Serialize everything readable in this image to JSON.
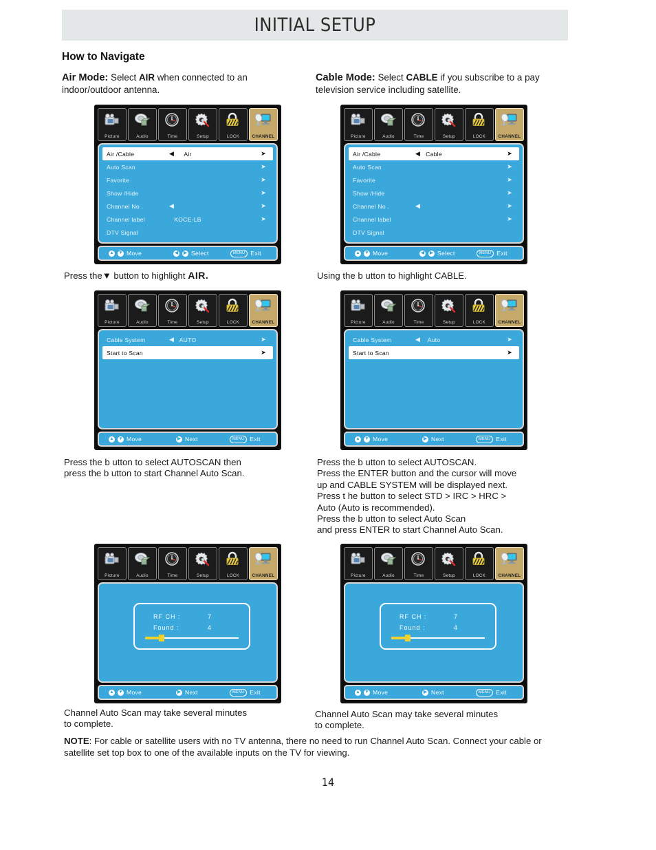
{
  "header": {
    "title": "INITIAL SETUP"
  },
  "section": {
    "how_to_navigate": "How to Navigate"
  },
  "intro": {
    "air": {
      "lead": "Air Mode:",
      "t1": " Select ",
      "bold1": "AIR",
      "t2": " when connected to an indoor/outdoor antenna."
    },
    "cable": {
      "lead": "Cable Mode:",
      "t1": " Select ",
      "bold1": "CABLE",
      "t2": " if you subscribe to a pay television service including satellite."
    }
  },
  "tabs": [
    {
      "label": "Picture",
      "icon": "camera-icon"
    },
    {
      "label": "Audio",
      "icon": "speaker-icon"
    },
    {
      "label": "Time",
      "icon": "clock-icon"
    },
    {
      "label": "Setup",
      "icon": "gear-wrench-icon"
    },
    {
      "label": "LOCK",
      "icon": "padlock-icon"
    },
    {
      "label": "CHANNEL",
      "icon": "monitor-antenna-icon"
    }
  ],
  "footers": {
    "move": "Move",
    "select": "Select",
    "next": "Next",
    "exit": "Exit",
    "menu_btn": "MENU"
  },
  "menu_air": {
    "rows": [
      {
        "label": "Air /Cable",
        "value": "Air",
        "left_arrow": true,
        "right_arrow": true,
        "selected": true
      },
      {
        "label": "Auto  Scan",
        "value": "",
        "left_arrow": false,
        "right_arrow": true,
        "selected": false
      },
      {
        "label": "Favorite",
        "value": "",
        "left_arrow": false,
        "right_arrow": true,
        "selected": false
      },
      {
        "label": "Show /Hide",
        "value": "",
        "left_arrow": false,
        "right_arrow": true,
        "selected": false
      },
      {
        "label": "Channel No .",
        "value": "",
        "left_arrow": true,
        "right_arrow": true,
        "selected": false
      },
      {
        "label": "Channel label",
        "value": "KOCE-LB",
        "left_arrow": false,
        "right_arrow": true,
        "selected": false
      },
      {
        "label": "DTV Signal",
        "value": "",
        "left_arrow": false,
        "right_arrow": false,
        "selected": false
      }
    ]
  },
  "menu_cable": {
    "rows": [
      {
        "label": "Air /Cable",
        "value": "Cable",
        "left_arrow": true,
        "right_arrow": true,
        "selected": true
      },
      {
        "label": "Auto  Scan",
        "value": "",
        "left_arrow": false,
        "right_arrow": true,
        "selected": false
      },
      {
        "label": "Favorite",
        "value": "",
        "left_arrow": false,
        "right_arrow": true,
        "selected": false
      },
      {
        "label": "Show /Hide",
        "value": "",
        "left_arrow": false,
        "right_arrow": true,
        "selected": false
      },
      {
        "label": "Channel No .",
        "value": "",
        "left_arrow": true,
        "right_arrow": true,
        "selected": false
      },
      {
        "label": "Channel label",
        "value": "",
        "left_arrow": false,
        "right_arrow": true,
        "selected": false
      },
      {
        "label": "DTV Signal",
        "value": "",
        "left_arrow": false,
        "right_arrow": false,
        "selected": false
      }
    ]
  },
  "menu_scan_air": {
    "rows": [
      {
        "label": "Cable System",
        "value": "AUTO",
        "left_arrow": true,
        "right_arrow": true,
        "selected": false
      },
      {
        "label": "Start  to Scan",
        "value": "",
        "left_arrow": false,
        "right_arrow": true,
        "selected": true
      }
    ]
  },
  "menu_scan_cable": {
    "rows": [
      {
        "label": "Cable System",
        "value": "Auto",
        "left_arrow": true,
        "right_arrow": true,
        "selected": false
      },
      {
        "label": "Start  to Scan",
        "value": "",
        "left_arrow": false,
        "right_arrow": true,
        "selected": true
      }
    ]
  },
  "progress": {
    "rf_label": "RF  CH :",
    "rf_value": "7",
    "found_label": "Found :",
    "found_value": "4",
    "percent": 18
  },
  "captions": {
    "air_step1": "Press the▼ button to highlight ",
    "air_step1_bold": "AIR.",
    "cable_step1": "Using the      b    utton to highlight CABLE.",
    "air_step2": "Press the  b    utton to select AUTOSCAN then\npress the  b    utton to start Channel Auto Scan.",
    "cable_step2": "Press the  b    utton to select AUTOSCAN.\nPress the ENTER button and the cursor will move\nup and CABLE SYSTEM will be displayed next.\n Press  t    he button to select STD > IRC > HRC >\nAuto (Auto is recommended).\n Press the  b    utton to select Auto Scan\nand press ENTER to start Channel Auto Scan.",
    "air_step3": "Channel Auto Scan may take several minutes\nto complete.",
    "cable_step3": "Channel Auto Scan may take several minutes\nto complete."
  },
  "note": {
    "label": "NOTE",
    "text": ": For cable or satellite users with no TV antenna, there no need to run Channel Auto Scan. Connect your cable or satellite set top box to one of the available inputs on the TV for viewing."
  },
  "page_number": "14",
  "colors": {
    "osd_blue": "#3aa8db",
    "tab_active": "#c4a96b",
    "header_bar": "#e3e7e7",
    "progress_yellow": "#f2d12a"
  }
}
